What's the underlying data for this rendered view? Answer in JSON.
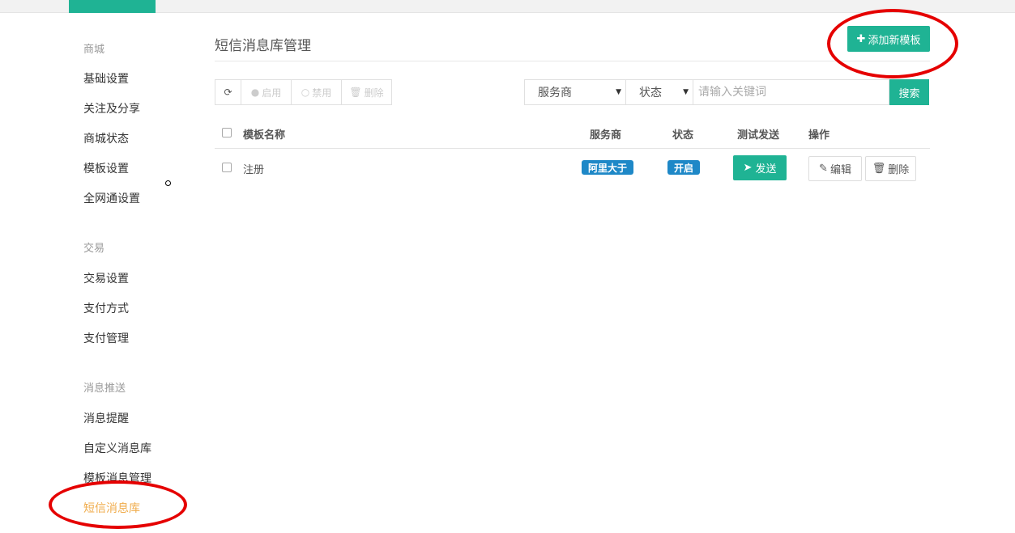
{
  "sidebar": {
    "groups": [
      {
        "title": "商城",
        "items": [
          "基础设置",
          "关注及分享",
          "商城状态",
          "模板设置",
          "全网通设置"
        ]
      },
      {
        "title": "交易",
        "items": [
          "交易设置",
          "支付方式",
          "支付管理"
        ]
      },
      {
        "title": "消息推送",
        "items": [
          "消息提醒",
          "自定义消息库",
          "模板消息管理",
          "短信消息库"
        ]
      }
    ],
    "active_item": "短信消息库"
  },
  "main": {
    "title": "短信消息库管理",
    "add_button": "添加新模板",
    "toolbar": {
      "enable": "启用",
      "disable": "禁用",
      "delete": "删除"
    },
    "filters": {
      "provider_select": "服务商",
      "status_select": "状态",
      "search_placeholder": "请输入关键词",
      "search_button": "搜索"
    },
    "table": {
      "headers": {
        "name": "模板名称",
        "provider": "服务商",
        "status": "状态",
        "test_send": "测试发送",
        "actions": "操作"
      },
      "rows": [
        {
          "name": "注册",
          "provider": "阿里大于",
          "status": "开启",
          "send": "发送",
          "edit": "编辑",
          "delete": "删除"
        }
      ]
    }
  },
  "colors": {
    "accent": "#1fb394",
    "badge": "#1e88c7",
    "active_nav": "#f0ad4e",
    "annotation": "#e50000"
  },
  "icons": [
    "refresh-icon",
    "dot-icon",
    "circle-icon",
    "trash-icon",
    "plus-icon",
    "send-icon",
    "edit-icon",
    "caret-down-icon"
  ]
}
